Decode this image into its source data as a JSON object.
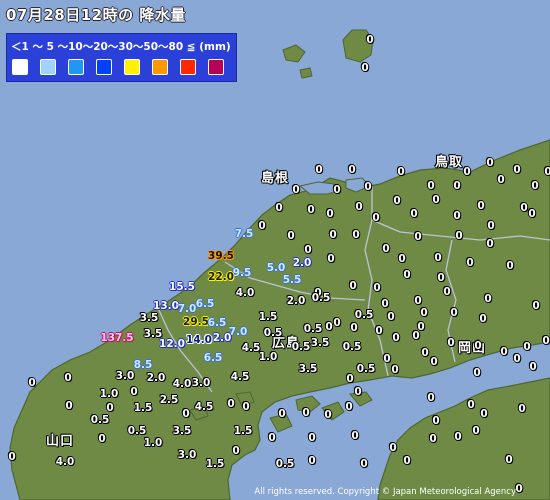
{
  "title": "07月28日12時の 降水量",
  "legend": {
    "scale": "＜1 ～ 5 ～10～20～30～50～80 ≦ (mm)",
    "colors": [
      "#ffffff",
      "#a0d2ff",
      "#2196f3",
      "#0041ff",
      "#fff200",
      "#ff9900",
      "#ff2800",
      "#b4005a"
    ]
  },
  "places": [
    "島根",
    "鳥取",
    "広島",
    "岡山",
    "山口"
  ],
  "copyright": "All rights reserved. Copyright © Japan Meteorological Agency",
  "colors": {
    "sea": "#8aa8d6",
    "land": "#6f8a45",
    "legend_box": "#2b3fd9"
  },
  "observations": [
    {
      "v": "0",
      "c": 0
    },
    {
      "v": "0",
      "c": 0
    },
    {
      "v": "0",
      "c": 0
    },
    {
      "v": "0",
      "c": 0
    },
    {
      "v": "0",
      "c": 0
    },
    {
      "v": "0",
      "c": 0
    },
    {
      "v": "0",
      "c": 0
    },
    {
      "v": "0",
      "c": 0
    },
    {
      "v": "0",
      "c": 0
    },
    {
      "v": "0",
      "c": 0
    },
    {
      "v": "0",
      "c": 0
    },
    {
      "v": "0",
      "c": 0
    },
    {
      "v": "0",
      "c": 0
    },
    {
      "v": "0",
      "c": 0
    },
    {
      "v": "0",
      "c": 0
    },
    {
      "v": "0",
      "c": 0
    },
    {
      "v": "0",
      "c": 0
    },
    {
      "v": "0",
      "c": 0
    },
    {
      "v": "0",
      "c": 0
    },
    {
      "v": "0",
      "c": 0
    },
    {
      "v": "0",
      "c": 0
    },
    {
      "v": "0",
      "c": 0
    },
    {
      "v": "0",
      "c": 0
    },
    {
      "v": "0",
      "c": 0
    },
    {
      "v": "0",
      "c": 0
    },
    {
      "v": "0",
      "c": 0
    },
    {
      "v": "0",
      "c": 0
    },
    {
      "v": "0",
      "c": 0
    },
    {
      "v": "0",
      "c": 0
    },
    {
      "v": "0",
      "c": 0
    },
    {
      "v": "0",
      "c": 0
    },
    {
      "v": "0",
      "c": 0
    },
    {
      "v": "0",
      "c": 0
    },
    {
      "v": "0",
      "c": 0
    },
    {
      "v": "0",
      "c": 0
    },
    {
      "v": "0",
      "c": 0
    },
    {
      "v": "7.5",
      "c": 1
    },
    {
      "v": "0",
      "c": 0
    },
    {
      "v": "0",
      "c": 0
    },
    {
      "v": "0",
      "c": 0
    },
    {
      "v": "0",
      "c": 0
    },
    {
      "v": "0",
      "c": 0
    },
    {
      "v": "0",
      "c": 0
    },
    {
      "v": "0",
      "c": 0
    },
    {
      "v": "39.5",
      "c": 5
    },
    {
      "v": "9.5",
      "c": 1
    },
    {
      "v": "5.0",
      "c": 1
    },
    {
      "v": "2.0",
      "c": 2
    },
    {
      "v": "0",
      "c": 0
    },
    {
      "v": "0",
      "c": 0
    },
    {
      "v": "0",
      "c": 0
    },
    {
      "v": "0",
      "c": 0
    },
    {
      "v": "22.0",
      "c": 4
    },
    {
      "v": "5.5",
      "c": 1
    },
    {
      "v": "0",
      "c": 0
    },
    {
      "v": "0",
      "c": 0
    },
    {
      "v": "0",
      "c": 0
    },
    {
      "v": "0",
      "c": 0
    },
    {
      "v": "0",
      "c": 0
    },
    {
      "v": "15.5",
      "c": 2
    },
    {
      "v": "4.0",
      "c": 0
    },
    {
      "v": "0",
      "c": 0
    },
    {
      "v": "0",
      "c": 0
    },
    {
      "v": "0",
      "c": 0
    },
    {
      "v": "0",
      "c": 0
    },
    {
      "v": "13.0",
      "c": 2
    },
    {
      "v": "6.5",
      "c": 1
    },
    {
      "v": "7.0",
      "c": 1
    },
    {
      "v": "2.0",
      "c": 0
    },
    {
      "v": "0.5",
      "c": 0
    },
    {
      "v": "0",
      "c": 0
    },
    {
      "v": "0.5",
      "c": 0
    },
    {
      "v": "0",
      "c": 0
    },
    {
      "v": "0",
      "c": 0
    },
    {
      "v": "3.5",
      "c": 0
    },
    {
      "v": "29.5",
      "c": 4
    },
    {
      "v": "6.5",
      "c": 1
    },
    {
      "v": "1.5",
      "c": 0
    },
    {
      "v": "0",
      "c": 0
    },
    {
      "v": "0",
      "c": 0
    },
    {
      "v": "0",
      "c": 0
    },
    {
      "v": "0",
      "c": 0
    },
    {
      "v": "137.5",
      "c": 7
    },
    {
      "v": "3.5",
      "c": 0
    },
    {
      "v": "7.0",
      "c": 1
    },
    {
      "v": "0.5",
      "c": 0
    },
    {
      "v": "0.5",
      "c": 0
    },
    {
      "v": "0",
      "c": 0
    },
    {
      "v": "0",
      "c": 0
    },
    {
      "v": "0",
      "c": 0
    },
    {
      "v": "12.0",
      "c": 2
    },
    {
      "v": "14.0",
      "c": 3
    },
    {
      "v": "2.0",
      "c": 2
    },
    {
      "v": "4.5",
      "c": 0
    },
    {
      "v": "0.5",
      "c": 0
    },
    {
      "v": "3.5",
      "c": 0
    },
    {
      "v": "0.5",
      "c": 0
    },
    {
      "v": "0",
      "c": 0
    },
    {
      "v": "0",
      "c": 0
    },
    {
      "v": "0",
      "c": 0
    },
    {
      "v": "8.5",
      "c": 1
    },
    {
      "v": "6.5",
      "c": 1
    },
    {
      "v": "1.0",
      "c": 0
    },
    {
      "v": "0.5",
      "c": 0
    },
    {
      "v": "0",
      "c": 0
    },
    {
      "v": "0",
      "c": 0
    },
    {
      "v": "0",
      "c": 0
    },
    {
      "v": "3.0",
      "c": 0
    },
    {
      "v": "2.0",
      "c": 0
    },
    {
      "v": "4.0",
      "c": 0
    },
    {
      "v": "3.0",
      "c": 0
    },
    {
      "v": "4.5",
      "c": 0
    },
    {
      "v": "3.5",
      "c": 0
    },
    {
      "v": "0",
      "c": 0
    },
    {
      "v": "0",
      "c": 0
    },
    {
      "v": "0",
      "c": 0
    },
    {
      "v": "0",
      "c": 0
    },
    {
      "v": "1.0",
      "c": 0
    },
    {
      "v": "2.5",
      "c": 0
    },
    {
      "v": "0",
      "c": 0
    },
    {
      "v": "0",
      "c": 0
    },
    {
      "v": "0",
      "c": 0
    },
    {
      "v": "0",
      "c": 0
    },
    {
      "v": "0",
      "c": 0
    },
    {
      "v": "1.5",
      "c": 0
    },
    {
      "v": "4.5",
      "c": 0
    },
    {
      "v": "0",
      "c": 0
    },
    {
      "v": "0",
      "c": 0
    },
    {
      "v": "0",
      "c": 0
    },
    {
      "v": "0",
      "c": 0
    },
    {
      "v": "0",
      "c": 0
    },
    {
      "v": "0",
      "c": 0
    },
    {
      "v": "0.5",
      "c": 0
    },
    {
      "v": "0",
      "c": 0
    },
    {
      "v": "0",
      "c": 0
    },
    {
      "v": "0",
      "c": 0
    },
    {
      "v": "0",
      "c": 0
    },
    {
      "v": "0",
      "c": 0
    },
    {
      "v": "3.5",
      "c": 0
    },
    {
      "v": "0",
      "c": 0
    },
    {
      "v": "1.5",
      "c": 0
    },
    {
      "v": "0",
      "c": 0
    },
    {
      "v": "0",
      "c": 0
    },
    {
      "v": "0",
      "c": 0
    },
    {
      "v": "0",
      "c": 0
    },
    {
      "v": "0",
      "c": 0
    },
    {
      "v": "1.0",
      "c": 0
    },
    {
      "v": "0.5",
      "c": 0
    },
    {
      "v": "0",
      "c": 0
    },
    {
      "v": "0",
      "c": 0
    },
    {
      "v": "0",
      "c": 0
    },
    {
      "v": "0",
      "c": 0
    },
    {
      "v": "0",
      "c": 0
    },
    {
      "v": "0",
      "c": 0
    },
    {
      "v": "0",
      "c": 0
    },
    {
      "v": "4.0",
      "c": 0
    },
    {
      "v": "3.0",
      "c": 0
    },
    {
      "v": "1.5",
      "c": 0
    },
    {
      "v": "0.5",
      "c": 0
    },
    {
      "v": "0",
      "c": 0
    },
    {
      "v": "0",
      "c": 0
    },
    {
      "v": "0",
      "c": 0
    },
    {
      "v": "0",
      "c": 0
    },
    {
      "v": "0",
      "c": 0
    }
  ]
}
